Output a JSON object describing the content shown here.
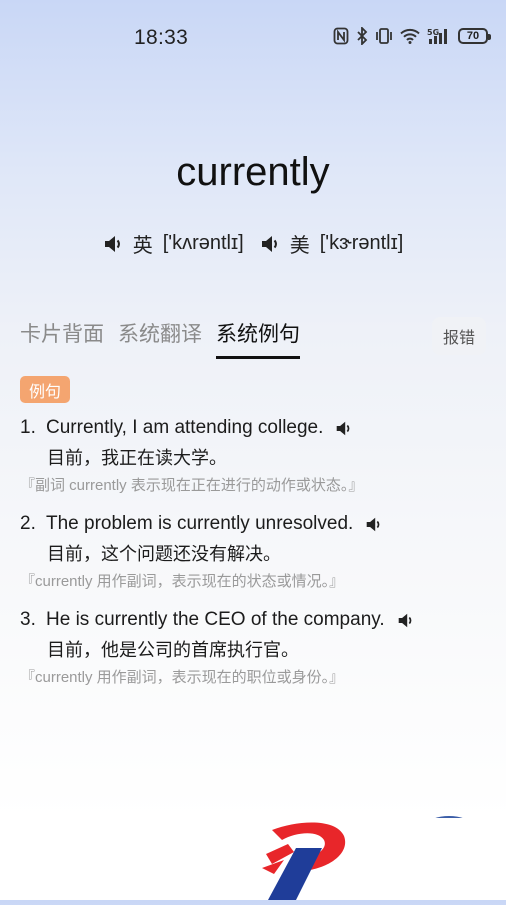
{
  "status_bar": {
    "time": "18:33",
    "battery": "70",
    "icons": [
      "nfc-icon",
      "bluetooth-icon",
      "vibrate-icon",
      "wifi-icon",
      "5g-signal-icon",
      "battery-icon"
    ]
  },
  "word": {
    "text": "currently",
    "uk_label": "英",
    "uk_phonetic": "['kʌrəntlɪ]",
    "us_label": "美",
    "us_phonetic": "['kɝrəntlɪ]"
  },
  "tabs": [
    {
      "label": "卡片背面",
      "active": false
    },
    {
      "label": "系统翻译",
      "active": false
    },
    {
      "label": "系统例句",
      "active": true
    }
  ],
  "report_label": "报错",
  "section_badge": "例句",
  "examples": [
    {
      "num": "1.",
      "en": "Currently, I am attending college.",
      "zh": "目前，我正在读大学。",
      "note": "『副词 currently 表示现在正在进行的动作或状态。』"
    },
    {
      "num": "2.",
      "en": "The problem is currently unresolved.",
      "zh": "目前，这个问题还没有解决。",
      "note": "『currently 用作副词，表示现在的状态或情况。』"
    },
    {
      "num": "3.",
      "en": "He is currently the CEO of the company.",
      "zh": "目前，他是公司的首席执行官。",
      "note": "『currently 用作副词，表示现在的职位或身份。』"
    }
  ],
  "colors": {
    "badge": "#f4a570",
    "logo_red": "#e8262a",
    "logo_blue": "#1f3d99"
  }
}
